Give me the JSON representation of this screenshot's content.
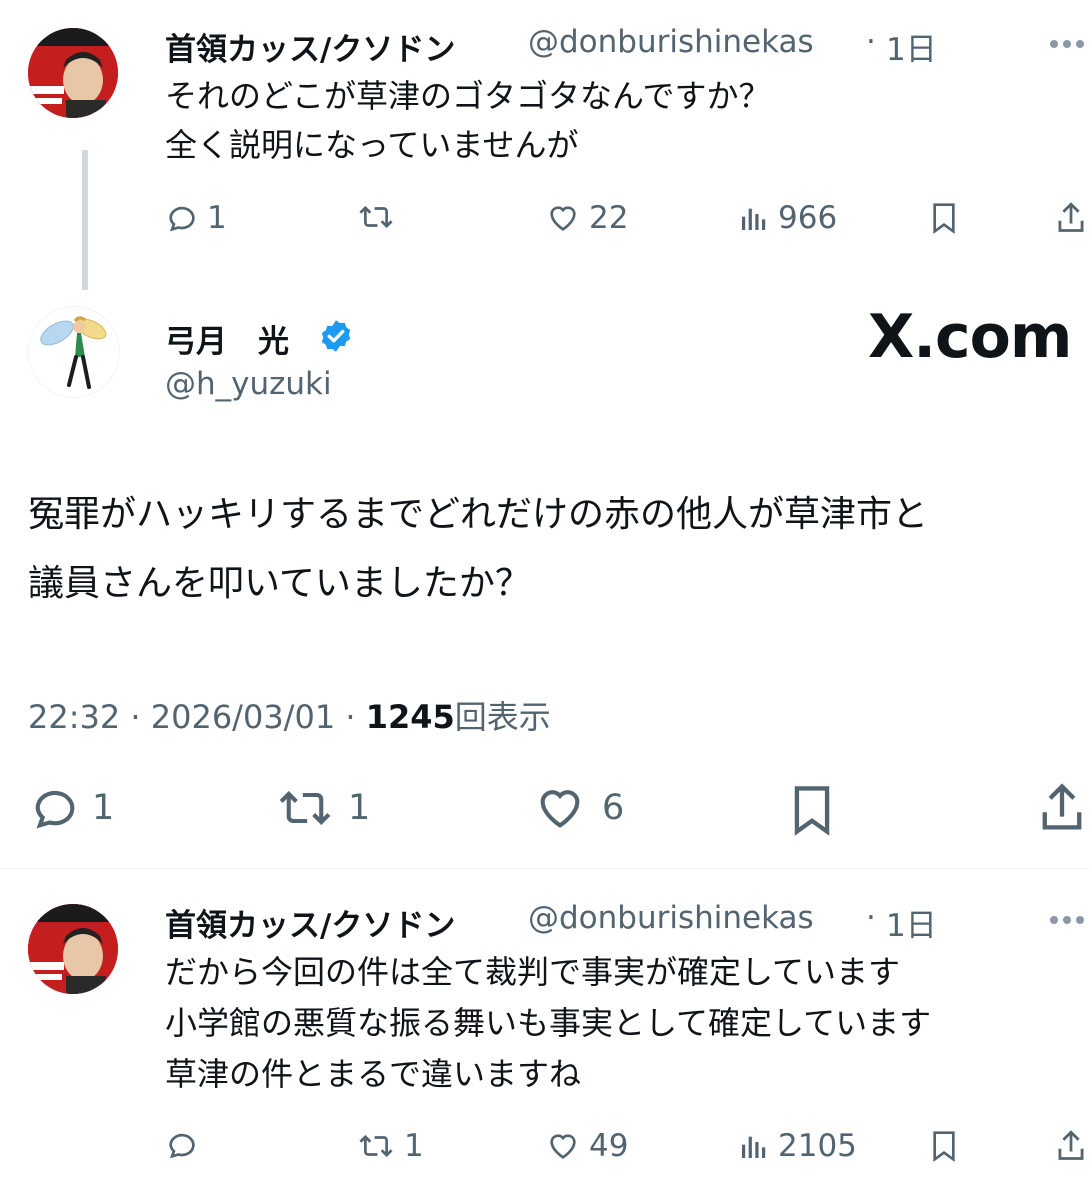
{
  "reply1": {
    "author_name": "首領カッス/クソドン",
    "author_handle": "@donburishinekas",
    "age": "1日",
    "separator": "·",
    "lines": [
      "それのどこが草津のゴタゴタなんですか？",
      "全く説明になっていませんが"
    ],
    "replies": "1",
    "retweets": "",
    "likes": "22",
    "views": "966"
  },
  "main": {
    "author_name": "弓月　光",
    "author_handle": "@h_yuzuki",
    "verified": true,
    "watermark": "X.com",
    "lines": [
      "冤罪がハッキリするまでどれだけの赤の他人が草津市と",
      "議員さんを叩いていましたか？"
    ],
    "timestamp": "22:32 · 2026/03/01 · ",
    "view_count": "1245",
    "view_label": "回表示",
    "replies": "1",
    "retweets": "1",
    "likes": "6"
  },
  "reply2": {
    "author_name": "首領カッス/クソドン",
    "author_handle": "@donburishinekas",
    "age": "1日",
    "separator": "·",
    "lines": [
      "だから今回の件は全て裁判で事実が確定しています",
      "小学館の悪質な振る舞いも事実として確定しています",
      "草津の件とまるで違いますね"
    ],
    "replies": "",
    "retweets": "1",
    "likes": "49",
    "views": "2105"
  },
  "colors": {
    "text": "#0f1419",
    "muted": "#536471",
    "verified": "#1d9bf0",
    "avatar_red": "#c41e1e"
  }
}
